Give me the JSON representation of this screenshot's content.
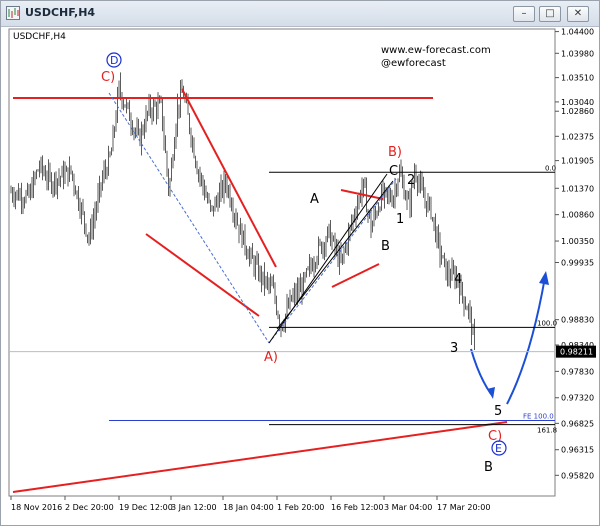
{
  "window": {
    "title": "USDCHF,H4",
    "controls": {
      "minimize": "–",
      "maximize": "□",
      "close": "✕"
    },
    "icons": {
      "app": "chart-window-icon",
      "minimize": "minimize-icon",
      "maximize": "maximize-icon",
      "close": "close-icon"
    }
  },
  "chart_data": {
    "type": "ohlc",
    "symbol_label": "USDCHF,H4",
    "watermark": [
      "www.ew-forecast.com",
      "@ewforecast"
    ],
    "ylim": [
      0.9542,
      1.0445
    ],
    "y_ticks": [
      "1.04400",
      "1.03980",
      "1.03510",
      "1.03040",
      "1.02860",
      "1.02375",
      "1.01905",
      "1.01370",
      "1.00860",
      "1.00350",
      "0.99935",
      "0.98830",
      "0.98340",
      "0.97830",
      "0.97320",
      "0.96825",
      "0.96315",
      "0.95820"
    ],
    "x_ticks": [
      "18 Nov 2016",
      "2 Dec 20:00",
      "19 Dec 12:00",
      "3 Jan 12:00",
      "18 Jan 04:00",
      "1 Feb 20:00",
      "16 Feb 12:00",
      "3 Mar 04:00",
      "17 Mar 20:00"
    ],
    "price_keypoints": [
      [
        0,
        1.013
      ],
      [
        18,
        1.012
      ],
      [
        28,
        1.018
      ],
      [
        40,
        1.015
      ],
      [
        60,
        1.017
      ],
      [
        78,
        1.004
      ],
      [
        92,
        1.016
      ],
      [
        100,
        1.02
      ],
      [
        108,
        1.033
      ],
      [
        118,
        1.028
      ],
      [
        128,
        1.023
      ],
      [
        138,
        1.029
      ],
      [
        150,
        1.0295
      ],
      [
        158,
        1.013
      ],
      [
        166,
        1.029
      ],
      [
        172,
        1.0325
      ],
      [
        186,
        1.018
      ],
      [
        200,
        1.009
      ],
      [
        215,
        1.015
      ],
      [
        228,
        1.006
      ],
      [
        240,
        1.0
      ],
      [
        252,
        0.996
      ],
      [
        262,
        0.994
      ],
      [
        270,
        0.987
      ],
      [
        280,
        0.992
      ],
      [
        292,
        0.995
      ],
      [
        305,
        1.001
      ],
      [
        318,
        1.005
      ],
      [
        330,
        0.999
      ],
      [
        342,
        1.008
      ],
      [
        352,
        1.0145
      ],
      [
        360,
        1.006
      ],
      [
        370,
        1.012
      ],
      [
        382,
        1.012
      ],
      [
        388,
        1.017
      ],
      [
        398,
        1.01
      ],
      [
        404,
        1.0175
      ],
      [
        412,
        1.012
      ],
      [
        420,
        1.0095
      ],
      [
        428,
        1.002
      ],
      [
        436,
        0.997
      ],
      [
        446,
        0.9965
      ],
      [
        452,
        0.9925
      ],
      [
        458,
        0.99
      ],
      [
        464,
        0.9822
      ]
    ],
    "current_price": "0.98211",
    "levels": [
      {
        "label": "0.0",
        "price": 1.0168
      },
      {
        "label": "100.0",
        "price": 0.9868
      },
      {
        "label": "FE 100.0",
        "price": 0.9688
      },
      {
        "label": "161.8",
        "price": 0.968
      }
    ],
    "wave_labels": [
      {
        "text": "D",
        "circled": true,
        "color": "#1a2fd1"
      },
      {
        "text": "C)",
        "color": "#e52020"
      },
      {
        "text": "A)",
        "color": "#e52020"
      },
      {
        "text": "B)",
        "color": "#e52020"
      },
      {
        "text": "A",
        "color": "#000000"
      },
      {
        "text": "B",
        "color": "#000000"
      },
      {
        "text": "C",
        "color": "#000000"
      },
      {
        "text": "1",
        "color": "#000000"
      },
      {
        "text": "2",
        "color": "#000000"
      },
      {
        "text": "3",
        "color": "#000000"
      },
      {
        "text": "4",
        "color": "#000000"
      },
      {
        "text": "5",
        "color": "#000000"
      },
      {
        "text": "C)",
        "color": "#e52020"
      },
      {
        "text": "E",
        "circled": true,
        "color": "#1a2fd1"
      },
      {
        "text": "B",
        "color": "#000000"
      }
    ],
    "colors": {
      "candles": "#5c5c5c",
      "trendline": "#e52020",
      "projection": "#1a4fd6",
      "channel": "#4a6fd0",
      "levels": "#000000",
      "fe_level": "#2b3fcf"
    }
  }
}
